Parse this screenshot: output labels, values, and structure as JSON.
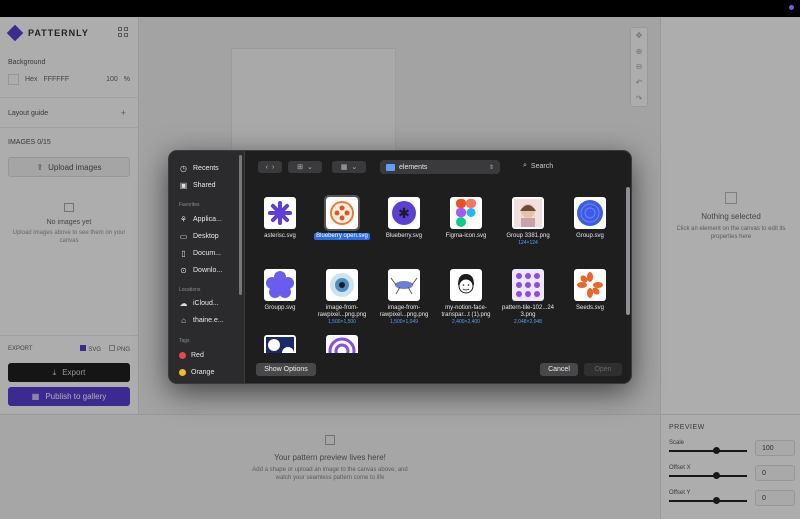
{
  "app": {
    "brand": "PATTERNLY",
    "sections": {
      "background": "Background",
      "bg_mode": "Hex",
      "bg_hex": "FFFFFF",
      "bg_opacity": "100",
      "bg_unit": "%",
      "layout_guide": "Layout guide",
      "images": "IMAGES",
      "images_count": "0/15",
      "upload": "Upload images",
      "no_images_title": "No images yet",
      "no_images_text": "Upload images above to see them on your canvas",
      "export": "EXPORT",
      "svg": "SVG",
      "png": "PNG",
      "export_btn": "Export",
      "publish_btn": "Publish to gallery"
    },
    "right_panel": {
      "title": "Nothing selected",
      "text": "Click an element on the canvas to edit its properties here"
    },
    "preview_empty": {
      "title": "Your pattern preview lives here!",
      "text": "Add a shape or upload an image to the canvas above, and watch your seamless pattern come to life"
    },
    "preview": {
      "title": "PREVIEW",
      "scale_label": "Scale",
      "scale_value": "100",
      "scale_level": 0.6,
      "offx_label": "Offset X",
      "offx_value": "0",
      "offx_level": 0.6,
      "offy_label": "Offset Y",
      "offy_value": "0",
      "offy_level": 0.6
    }
  },
  "dialog": {
    "sidebar": {
      "recents": "Recents",
      "shared": "Shared",
      "favorites_head": "Favorites",
      "applications": "Applica...",
      "desktop": "Desktop",
      "documents": "Docum...",
      "downloads": "Downlo...",
      "locations_head": "Locations",
      "icloud": "iCloud...",
      "home": "thaine.e...",
      "tags_head": "Tags",
      "tag_red": "Red",
      "tag_orange": "Orange"
    },
    "folder": "elements",
    "search": "Search",
    "files": [
      {
        "name": "asterisc.svg",
        "meta": ""
      },
      {
        "name": "Blueberry open.svg",
        "meta": ""
      },
      {
        "name": "Blueberry.svg",
        "meta": ""
      },
      {
        "name": "Figma-icon.svg",
        "meta": ""
      },
      {
        "name": "Group 3381.png",
        "meta": "124×124"
      },
      {
        "name": "Group.svg",
        "meta": ""
      },
      {
        "name": "Groupp.svg",
        "meta": ""
      },
      {
        "name": "image-from-rawpixel...png.png",
        "meta": "1,500×1,500"
      },
      {
        "name": "image-from-rawpixel...png.png",
        "meta": "1,500×1,049"
      },
      {
        "name": "my-notion-face-transpar...t (1).png",
        "meta": "2,400×2,400"
      },
      {
        "name": "pattern-tile-102...24 3.png",
        "meta": "2,048×2,048"
      },
      {
        "name": "Seeds.svg",
        "meta": ""
      }
    ],
    "buttons": {
      "show_options": "Show Options",
      "cancel": "Cancel",
      "open": "Open"
    }
  },
  "colors": {
    "accent": "#5b3fd6",
    "selection": "#2a6ee6",
    "tag_red": "#e5484d",
    "tag_orange": "#f5b82e"
  }
}
